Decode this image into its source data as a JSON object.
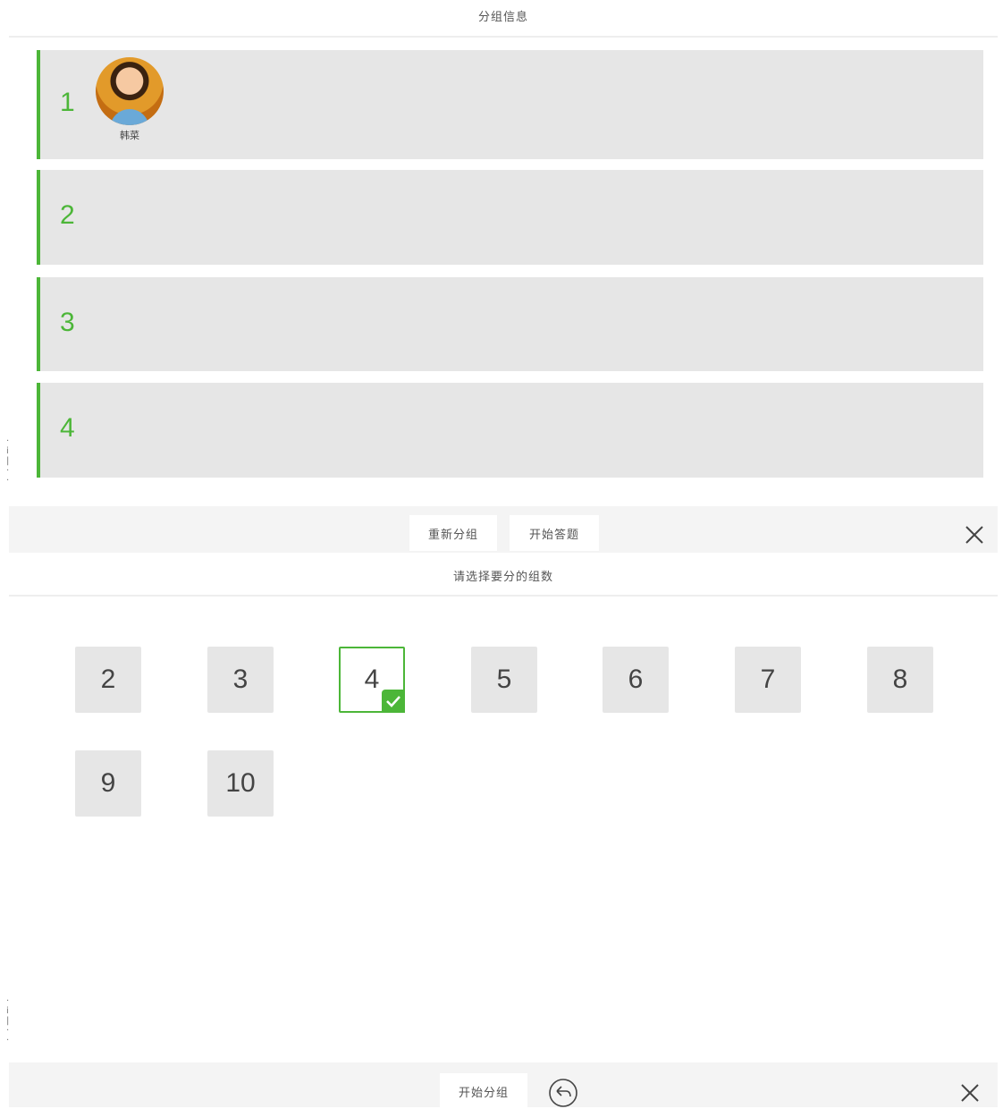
{
  "info_panel": {
    "title": "分组信息",
    "groups": [
      {
        "label": "1",
        "members": [
          {
            "name": "韩菜"
          }
        ]
      },
      {
        "label": "2",
        "members": []
      },
      {
        "label": "3",
        "members": []
      },
      {
        "label": "4",
        "members": []
      }
    ],
    "regroup_button": "重新分组",
    "start_answer_button": "开始答题"
  },
  "select_panel": {
    "title": "请选择要分的组数",
    "options": [
      "2",
      "3",
      "4",
      "5",
      "6",
      "7",
      "8",
      "9",
      "10"
    ],
    "selected": "4",
    "start_group_button": "开始分组"
  },
  "colors": {
    "accent": "#4cb638",
    "row_bg": "#e6e6e6",
    "toolbar_bg": "#f4f4f4"
  },
  "icons": {
    "close": "close-icon",
    "back": "undo-arrow-icon",
    "check": "check-icon"
  }
}
